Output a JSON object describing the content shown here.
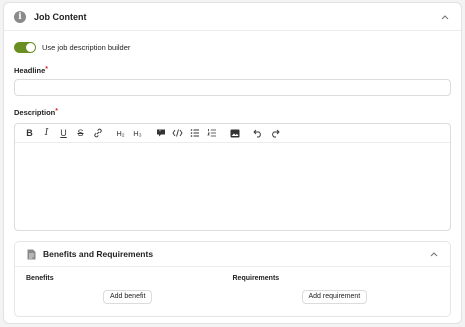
{
  "section": {
    "title": "Job Content",
    "icon": "info-icon",
    "collapse_icon": "chevron-up-icon"
  },
  "toggle": {
    "label": "Use job description builder",
    "on": true,
    "color": "#6b8e23"
  },
  "headline": {
    "label": "Headline",
    "required_mark": "*",
    "value": "",
    "placeholder": ""
  },
  "description": {
    "label": "Description",
    "required_mark": "*",
    "toolbar": {
      "bold": "B",
      "italic": "I",
      "underline": "U",
      "strike": "S",
      "h2": "H₂",
      "h3": "H₃"
    },
    "value": ""
  },
  "benefits_requirements": {
    "title": "Benefits and Requirements",
    "benefits_label": "Benefits",
    "add_benefit": "Add benefit",
    "requirements_label": "Requirements",
    "add_requirement": "Add requirement"
  }
}
